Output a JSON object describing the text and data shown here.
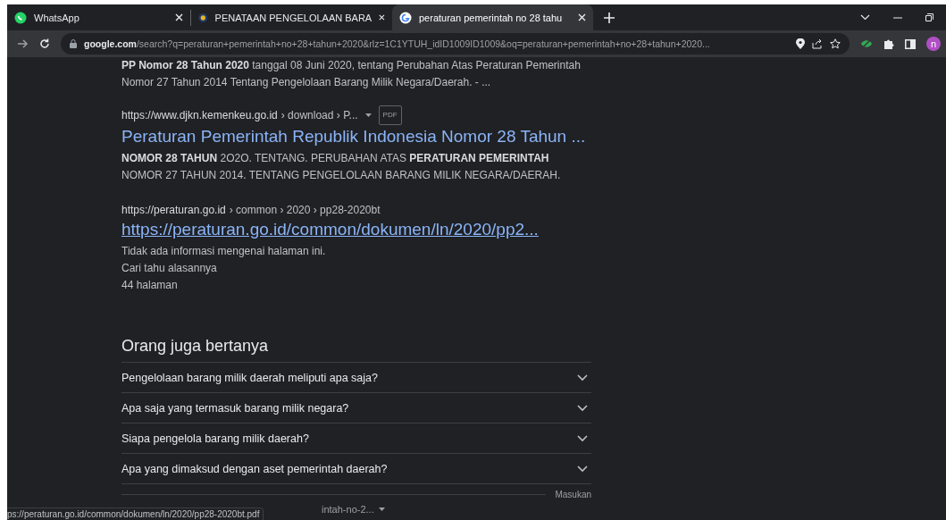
{
  "tabs": [
    {
      "title": "WhatsApp",
      "selected": false
    },
    {
      "title": "PENATAAN PENGELOLAAN BARA",
      "selected": false
    },
    {
      "title": "peraturan pemerintah no 28 tahu",
      "selected": true
    }
  ],
  "address": {
    "host": "google.com",
    "path": "/search?q=peraturan+pemerintah+no+28+tahun+2020&rlz=1C1YTUH_idID1009ID1009&oq=peraturan+pemerintah+no+28+tahun+2020..."
  },
  "profile": {
    "initial": "n"
  },
  "top_snippet": [
    "**PP Nomor 28 Tahun 2020** tanggal 08 Juni 2020, tentang Perubahan Atas Peraturan Pemerintah",
    "Nomor 27 Tahun 2014 Tentang Pengelolaan Barang Milik Negara/Daerah. - ..."
  ],
  "results": [
    {
      "kind": "heading",
      "site": "https://www.djkn.kemenkeu.go.id",
      "crumbs": "› download › P...",
      "badge": "PDF",
      "title": "Peraturan Pemerintah Republik Indonesia Nomor 28 Tahun ...",
      "lines": [
        "**NOMOR 28 TAHUN** 2O2O. TENTANG. PERUBAHAN ATAS **PERATURAN PEMERINTAH**",
        "NOMOR 27 TAHUN 2014. TENTANG PENGELOLAAN BARANG MILIK NEGARA/DAERAH."
      ]
    },
    {
      "kind": "url",
      "site": "https://peraturan.go.id",
      "crumbs": "› common › 2020 › pp28-2020bt",
      "title": "https://peraturan.go.id/common/dokumen/ln/2020/pp2...",
      "lines": [
        "Tidak ada informasi mengenai halaman ini.",
        "Cari tahu alasannya",
        "44 halaman"
      ]
    }
  ],
  "people_also_ask": {
    "title": "Orang juga bertanya",
    "questions": [
      {
        "text": "Pengelolaan barang milik daerah meliputi apa saja?",
        "expanded": false
      },
      {
        "text": "Apa saja yang termasuk barang milik negara?",
        "expanded": false
      },
      {
        "text": "Siapa pengelola barang milik daerah?",
        "expanded": false
      },
      {
        "text": "Apa yang dimaksud dengan aset pemerintah daerah?",
        "expanded": false
      }
    ],
    "feedback": "Masukan"
  },
  "status_bar": {
    "url": "ps://peraturan.go.id/common/dokumen/ln/2020/pp28-2020bt.pdf",
    "download": "intah-no-2..."
  }
}
